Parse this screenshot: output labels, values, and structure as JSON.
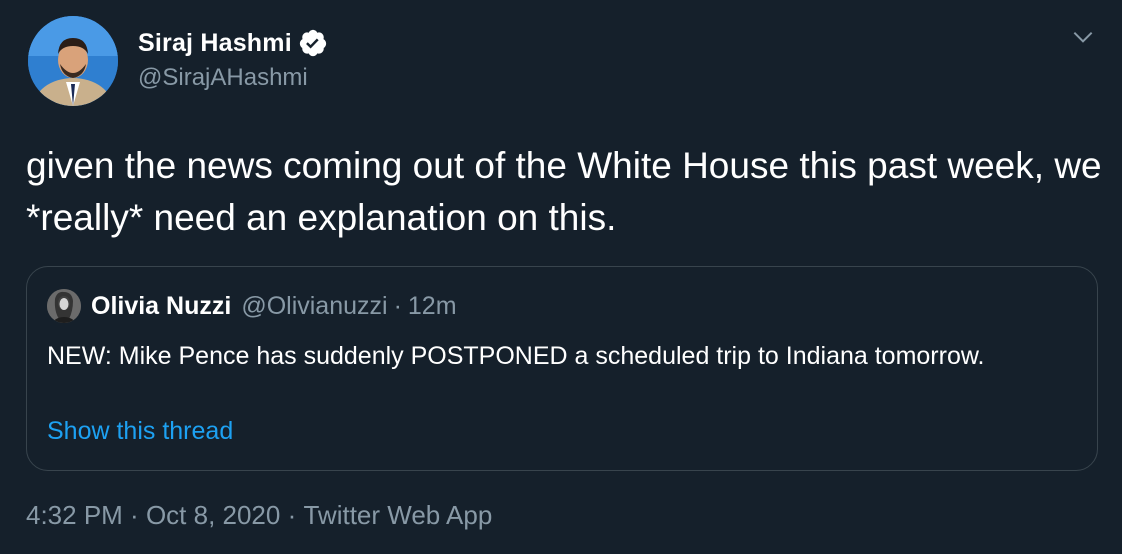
{
  "author": {
    "name": "Siraj Hashmi",
    "handle": "@SirajAHashmi",
    "verified_icon": "verified-badge-icon"
  },
  "tweet": {
    "text": "given the news coming out of the White House this past week, we *really* need an explanation on this."
  },
  "quoted": {
    "name": "Olivia Nuzzi",
    "handle": "@Olivianuzzi",
    "separator": "·",
    "time": "12m",
    "text": "NEW: Mike Pence has suddenly POSTPONED a scheduled trip to Indiana tomorrow.",
    "show_thread_label": "Show this thread"
  },
  "meta": {
    "time": "4:32 PM",
    "separator": " · ",
    "date": "Oct 8, 2020",
    "source": "Twitter Web App"
  },
  "colors": {
    "background": "#15202b",
    "secondary_text": "#8899a6",
    "link": "#1da1f2",
    "border": "#38444d"
  }
}
